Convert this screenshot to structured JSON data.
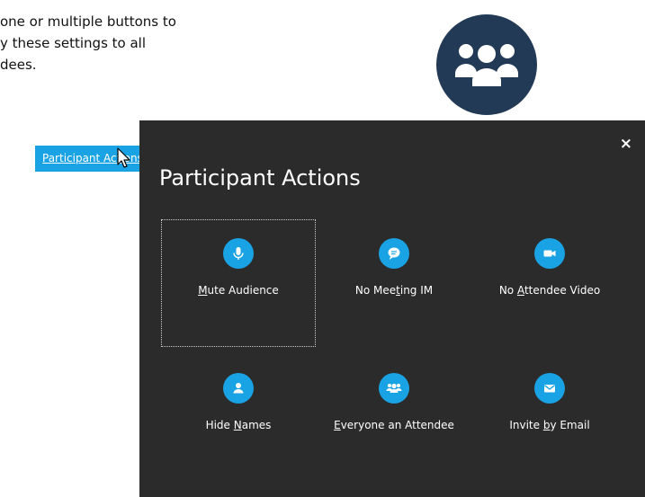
{
  "instruction": {
    "line1": "one or multiple buttons to",
    "line2": "y these settings to all",
    "line3": "dees."
  },
  "trigger": {
    "label": "Participant Actions"
  },
  "dialog": {
    "title": "Participant Actions",
    "close_label": "×",
    "actions": [
      {
        "pre": "",
        "u": "M",
        "post": "ute Audience",
        "icon": "microphone-icon"
      },
      {
        "pre": "No Mee",
        "u": "t",
        "post": "ing IM",
        "icon": "chat-icon"
      },
      {
        "pre": "No ",
        "u": "A",
        "post": "ttendee Video",
        "icon": "video-camera-icon"
      },
      {
        "pre": "Hide ",
        "u": "N",
        "post": "ames",
        "icon": "person-icon"
      },
      {
        "pre": "",
        "u": "E",
        "post": "veryone an Attendee",
        "icon": "people-icon"
      },
      {
        "pre": "Invite ",
        "u": "b",
        "post": "y Email",
        "icon": "envelope-icon"
      }
    ]
  },
  "colors": {
    "accent": "#1aa3e4",
    "panel": "#2b2b2b",
    "circle": "#223a55"
  }
}
